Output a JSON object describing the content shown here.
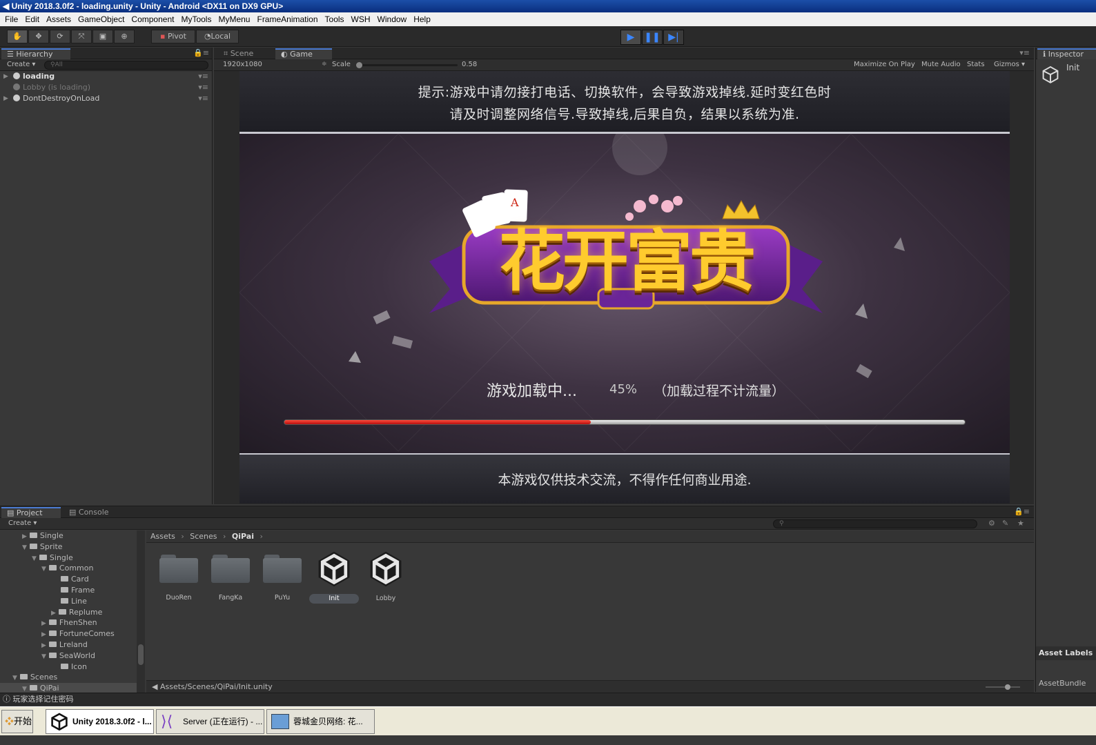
{
  "window": {
    "title": "Unity 2018.3.0f2 - loading.unity - Unity - Android <DX11 on DX9 GPU>"
  },
  "menu": [
    "File",
    "Edit",
    "Assets",
    "GameObject",
    "Component",
    "MyTools",
    "MyMenu",
    "FrameAnimation",
    "Tools",
    "WSH",
    "Window",
    "Help"
  ],
  "toolbar": {
    "pivot": "Pivot",
    "local": "Local"
  },
  "hierarchy": {
    "tab": "Hierarchy",
    "create": "Create",
    "search_placeholder": "All",
    "items": [
      {
        "label": "loading",
        "bold": true
      },
      {
        "label": "Lobby (is loading)",
        "dim": true
      },
      {
        "label": "DontDestroyOnLoad"
      }
    ]
  },
  "scene_view": {
    "scene_tab": "Scene",
    "game_tab": "Game",
    "resolution": "1920x1080",
    "scale_label": "Scale",
    "scale_value": "0.58",
    "buttons": [
      "Maximize On Play",
      "Mute Audio",
      "Stats",
      "Gizmos"
    ]
  },
  "inspector": {
    "tab": "Inspector",
    "object": "Init",
    "asset_labels": "Asset Labels",
    "asset_bundle": "AssetBundle"
  },
  "game": {
    "notice_line1": "提示:游戏中请勿接打电话、切换软件，会导致游戏掉线.延时变红色时",
    "notice_line2": "请及时调整网络信号.导致掉线,后果自负，结果以系统为准.",
    "logo_text": "花开富贵",
    "loading_text": "游戏加载中...",
    "percent_text": "45%",
    "loading_note": "（加载过程不计流量）",
    "progress": 0.45,
    "footer": "本游戏仅供技术交流，不得作任何商业用途."
  },
  "project": {
    "tab": "Project",
    "console_tab": "Console",
    "create": "Create",
    "tree": [
      {
        "label": "Single",
        "depth": 2,
        "open": false
      },
      {
        "label": "Sprite",
        "depth": 2,
        "open": true
      },
      {
        "label": "Single",
        "depth": 3,
        "open": true
      },
      {
        "label": "Common",
        "depth": 4,
        "open": true
      },
      {
        "label": "Card",
        "depth": 5
      },
      {
        "label": "Frame",
        "depth": 5
      },
      {
        "label": "Line",
        "depth": 5
      },
      {
        "label": "Replume",
        "depth": 5,
        "open": false
      },
      {
        "label": "FhenShen",
        "depth": 4,
        "open": false
      },
      {
        "label": "FortuneComes",
        "depth": 4,
        "open": false
      },
      {
        "label": "Lreland",
        "depth": 4,
        "open": false
      },
      {
        "label": "SeaWorld",
        "depth": 4,
        "open": true
      },
      {
        "label": "Icon",
        "depth": 5
      },
      {
        "label": "Scenes",
        "depth": 1,
        "open": true
      },
      {
        "label": "QiPai",
        "depth": 2,
        "open": true,
        "selected": true
      }
    ],
    "breadcrumb": [
      "Assets",
      "Scenes",
      "QiPai"
    ],
    "assets": [
      {
        "label": "DuoRen",
        "type": "folder"
      },
      {
        "label": "FangKa",
        "type": "folder"
      },
      {
        "label": "PuYu",
        "type": "folder"
      },
      {
        "label": "Init",
        "type": "scene",
        "selected": true
      },
      {
        "label": "Lobby",
        "type": "scene"
      }
    ],
    "path": "Assets/Scenes/QiPai/Init.unity"
  },
  "status": {
    "message": "玩家选择记住密码"
  },
  "taskbar": {
    "start": "开始",
    "items": [
      "Unity 2018.3.0f2 - l...",
      "Server (正在运行) - ...",
      "蓉城金贝网络: 花..."
    ]
  }
}
